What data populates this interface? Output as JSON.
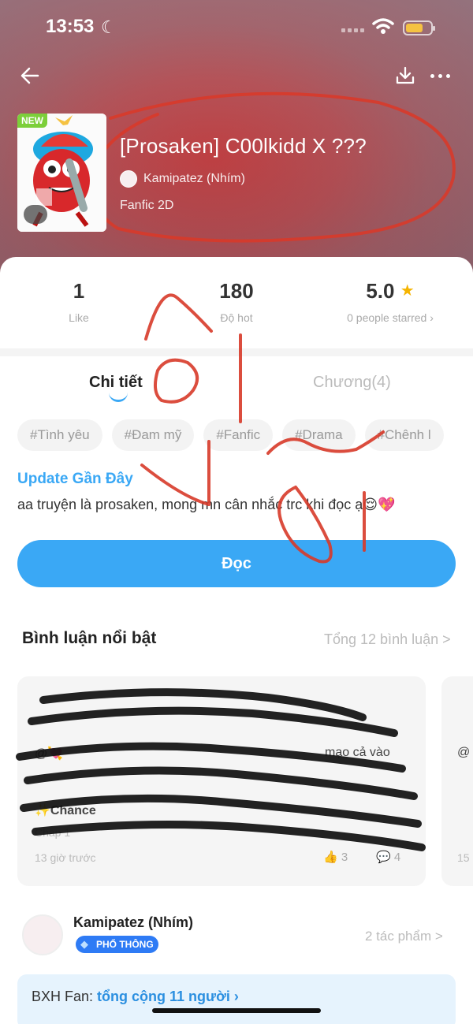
{
  "status_bar": {
    "time": "13:53"
  },
  "work": {
    "badge": "NEW",
    "title": "[Prosaken] C00lkidd X ???",
    "author": "Kamipatez (Nhím)",
    "category": "Fanfic 2D"
  },
  "stats": {
    "like_value": "1",
    "like_label": "Like",
    "hot_value": "180",
    "hot_label": "Độ hot",
    "rating_value": "5.0",
    "rating_label": "0 people starred ›"
  },
  "tabs": {
    "detail": "Chi tiết",
    "chapters": "Chương(4)"
  },
  "tags": [
    "#Tình yêu",
    "#Đam mỹ",
    "#Fanfic",
    "#Drama",
    "#Chênh l"
  ],
  "update": {
    "title": "Update Gần Đây",
    "text": "aa truyện là prosaken, mong mn cân nhắc trc khi đọc ạ😌",
    "emoji": "💖"
  },
  "read_button": "Đọc",
  "comments": {
    "title": "Bình luận nổi bật",
    "total": "Tổng 12 bình luận >",
    "card": {
      "line1": "@💘",
      "line1_tail": "mạo cả vào",
      "line3": "✨Chance",
      "line4": "Chap 1",
      "time": "13 giờ trước",
      "likes": "3",
      "replies": "4"
    },
    "card2": {
      "line1": "@",
      "time": "15"
    }
  },
  "author_card": {
    "name": "Kamipatez (Nhím)",
    "badge": "PHỔ THÔNG",
    "works": "2 tác phẩm >"
  },
  "fan_banner": {
    "label": "BXH Fan:",
    "count": "tổng cộng 11 người ›"
  },
  "colors": {
    "accent": "#3aa8f5",
    "header": "#c13a3d",
    "scribble": "#d83a2a"
  }
}
